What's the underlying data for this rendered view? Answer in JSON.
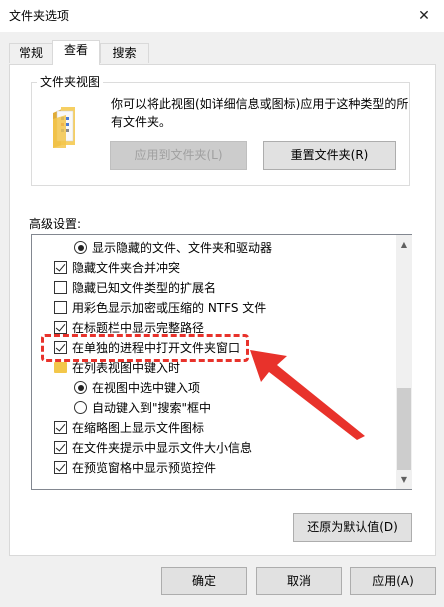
{
  "window": {
    "title": "文件夹选项",
    "close_icon": "close-icon"
  },
  "tabs": [
    {
      "label": "常规",
      "active": false
    },
    {
      "label": "查看",
      "active": true
    },
    {
      "label": "搜索",
      "active": false
    }
  ],
  "folder_views": {
    "group_title": "文件夹视图",
    "description_line1": "你可以将此视图(如详细信息或图标)应用于这种类型的所",
    "description_line2": "有文件夹。",
    "apply_button": "应用到文件夹(L)",
    "reset_button": "重置文件夹(R)"
  },
  "advanced": {
    "label": "高级设置:",
    "items": [
      {
        "type": "radio",
        "checked": true,
        "label": "显示隐藏的文件、文件夹和驱动器"
      },
      {
        "type": "checkbox",
        "checked": true,
        "label": "隐藏文件夹合并冲突"
      },
      {
        "type": "checkbox",
        "checked": false,
        "label": "隐藏已知文件类型的扩展名"
      },
      {
        "type": "checkbox",
        "checked": false,
        "label": "用彩色显示加密或压缩的 NTFS 文件"
      },
      {
        "type": "checkbox",
        "checked": true,
        "label": "在标题栏中显示完整路径"
      },
      {
        "type": "checkbox",
        "checked": true,
        "label": "在单独的进程中打开文件夹窗口"
      },
      {
        "type": "folder",
        "label": "在列表视图中键入时"
      },
      {
        "type": "radio",
        "checked": true,
        "label": "在视图中选中键入项"
      },
      {
        "type": "radio",
        "checked": false,
        "label": "自动键入到\"搜索\"框中"
      },
      {
        "type": "checkbox",
        "checked": true,
        "label": "在缩略图上显示文件图标"
      },
      {
        "type": "checkbox",
        "checked": true,
        "label": "在文件夹提示中显示文件大小信息"
      },
      {
        "type": "checkbox",
        "checked": true,
        "label": "在预览窗格中显示预览控件"
      }
    ],
    "restore_defaults_button": "还原为默认值(D)"
  },
  "footer": {
    "ok_button": "确定",
    "cancel_button": "取消",
    "apply_button": "应用(A)"
  },
  "annotation": {
    "color": "#e8322b"
  }
}
